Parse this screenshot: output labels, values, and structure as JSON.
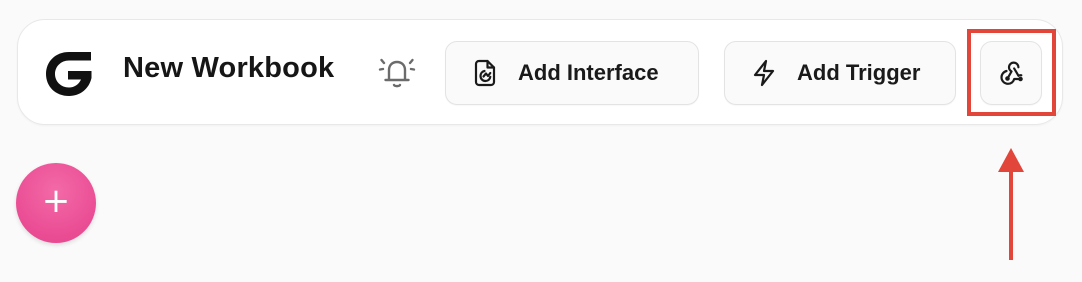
{
  "header": {
    "logo_icon": "g-logo-icon",
    "title": "New Workbook",
    "bell_icon": "bell-icon"
  },
  "toolbar": {
    "add_interface_label": "Add Interface",
    "add_interface_icon": "interface-file-icon",
    "add_trigger_label": "Add Trigger",
    "add_trigger_icon": "lightning-icon",
    "webhook_icon": "webhook-icon"
  },
  "fab": {
    "label": "+",
    "icon": "plus-icon"
  },
  "annotation": {
    "highlight_color": "#e2453a",
    "description_target": "webhook-button"
  },
  "colors": {
    "fab": "#ea4c93",
    "highlight": "#e2453a",
    "text": "#161616",
    "background": "#fafafa"
  }
}
